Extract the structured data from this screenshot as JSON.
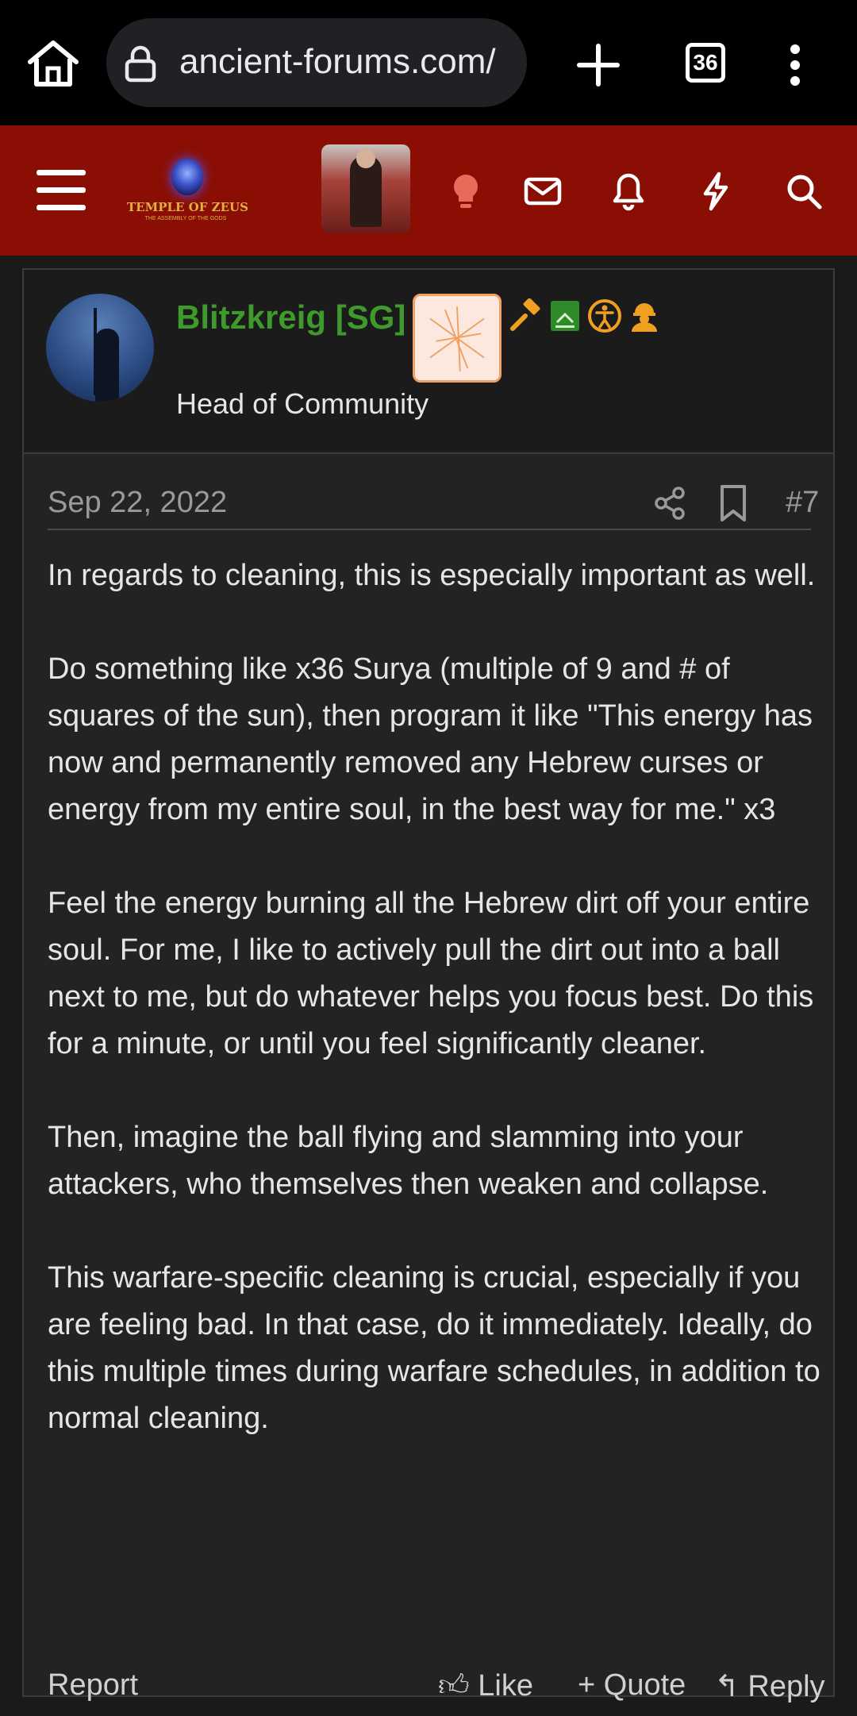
{
  "browser": {
    "url": "ancient-forums.com/",
    "tab_count": "36"
  },
  "forum_header": {
    "logo_title": "TEMPLE OF ZEUS",
    "logo_subtitle": "THE ASSEMBLY OF THE GODS"
  },
  "post": {
    "username": "Blitzkreig [SG]",
    "user_title": "Head of Community",
    "date": "Sep 22, 2022",
    "number": "#7",
    "paragraphs": [
      "In regards to cleaning, this is especially important as well.",
      "Do something like x36 Surya (multiple of 9 and # of squares of the sun), then program it like \"This energy has now and permanently removed any Hebrew curses or energy from my entire soul, in the best way for me.\" x3",
      "Feel the energy burning all the Hebrew dirt off your entire soul. For me, I like to actively pull the dirt out into a ball next to me, but do whatever helps you focus best. Do this for a minute, or until you feel significantly cleaner.",
      "Then, imagine the ball flying and slamming into your attackers, who themselves then weaken and collapse.",
      "This warfare-specific cleaning is crucial, especially if you are feeling bad. In that case, do it immediately. Ideally, do this multiple times during warfare schedules, in addition to normal cleaning."
    ],
    "actions": {
      "report": "Report",
      "like": "Like",
      "quote": "Quote",
      "reply": "Reply"
    }
  },
  "colors": {
    "header_bg": "#8b0e04",
    "username_green": "#3e9b2b",
    "role_icon_orange": "#f0a020",
    "page_bg": "#1a1a1a"
  },
  "icons": [
    "home-icon",
    "lock-icon",
    "plus-icon",
    "tabs-icon",
    "more-vert-icon",
    "menu-icon",
    "lightbulb-icon",
    "envelope-icon",
    "bell-icon",
    "bolt-icon",
    "search-icon",
    "gavel-icon",
    "book-icon",
    "accessibility-icon",
    "worker-icon",
    "share-icon",
    "bookmark-icon",
    "thumbs-up-icon",
    "quote-icon",
    "reply-icon"
  ]
}
